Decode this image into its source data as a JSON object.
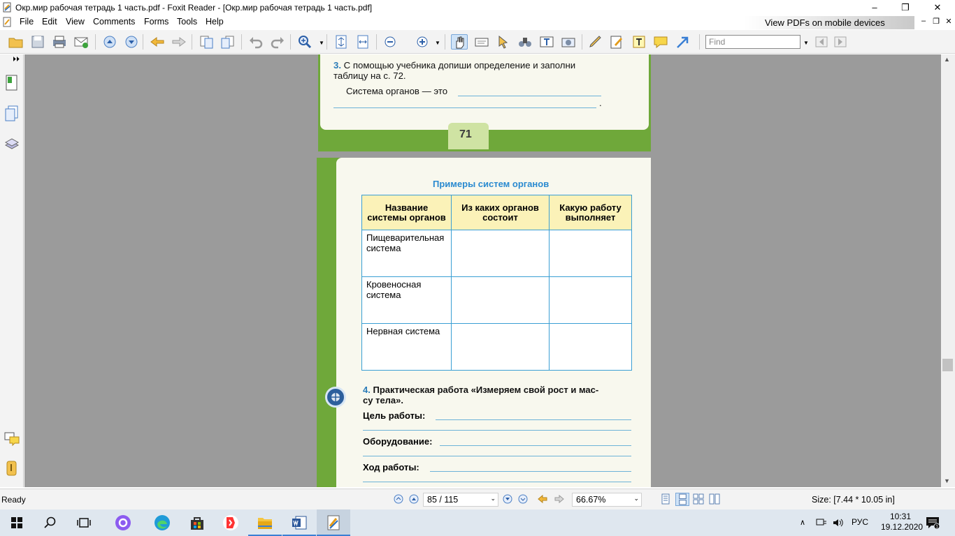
{
  "window": {
    "title": "Окр.мир рабочая тетрадь 1 часть.pdf - Foxit Reader - [Окр.мир рабочая тетрадь 1 часть.pdf]",
    "minimize": "–",
    "restore": "❐",
    "close": "✕"
  },
  "menu": {
    "items": [
      "File",
      "Edit",
      "View",
      "Comments",
      "Forms",
      "Tools",
      "Help"
    ]
  },
  "ad": {
    "text": "View PDFs on mobile devices"
  },
  "mdi": {
    "minimize": "–",
    "restore": "❐",
    "close": "✕"
  },
  "toolbar": {
    "find_placeholder": "Find"
  },
  "doc": {
    "page1": {
      "q3_num": "3.",
      "q3_line1": "С помощью учебника допиши определение и заполни",
      "q3_line2": "таблицу на с. 72.",
      "definition_label": "Система органов — это",
      "period": ".",
      "page_number": "71"
    },
    "page2": {
      "table_title": "Примеры систем органов",
      "headers": [
        "Название системы органов",
        "Из каких органов состоит",
        "Какую работу выполняет"
      ],
      "rows": [
        {
          "name": "Пищеварительная система"
        },
        {
          "name": "Кровеносная система"
        },
        {
          "name": "Нервная система"
        }
      ],
      "q4_num": "4.",
      "q4_line1": "Практическая работа «Измеряем свой рост и мас-",
      "q4_line2": "су тела».",
      "goal_label": "Цель работы:",
      "equipment_label": "Оборудование:",
      "procedure_label": "Ход работы:"
    }
  },
  "status": {
    "ready": "Ready",
    "page_field": "85 / 115",
    "zoom_field": "66.67%",
    "size": "Size: [7.44 * 10.05 in]"
  },
  "taskbar": {
    "lang": "РУС",
    "time": "10:31",
    "date": "19.12.2020"
  },
  "colors": {
    "accent": "#3a9fd4",
    "page_green": "#6fa83a",
    "header_yellow": "#fbf2b8",
    "title_blue": "#2a8ad0"
  }
}
